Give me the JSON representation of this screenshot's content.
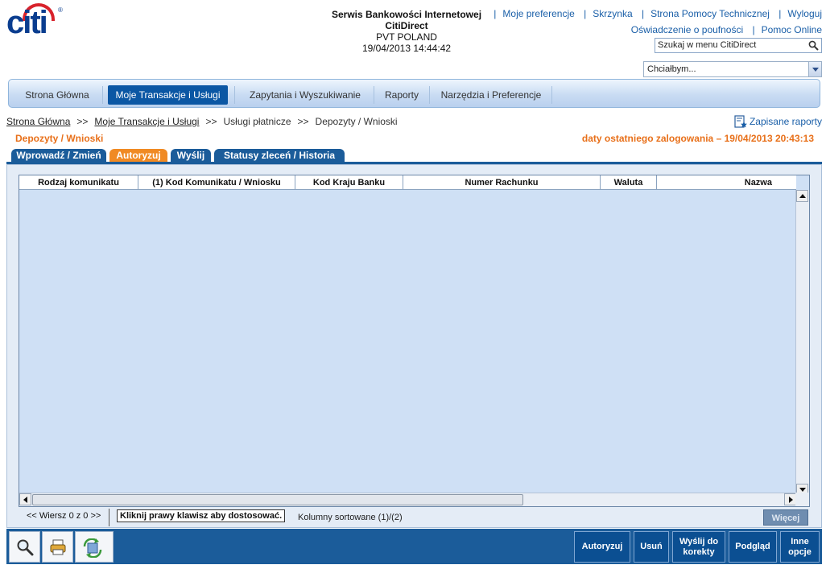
{
  "brand": {
    "logo_text": "citi",
    "registered": "®"
  },
  "header": {
    "service_line1": "Serwis Bankowości Internetowej",
    "service_line2": "CitiDirect",
    "service_line3": "PVT POLAND",
    "service_datetime": "19/04/2013 14:44:42",
    "links_row1": [
      "Moje preferencje",
      "Skrzynka",
      "Strona Pomocy Technicznej",
      "Wyloguj"
    ],
    "links_row2": [
      "Oświadczenie o poufności",
      "Pomoc Online"
    ],
    "search_value": "Szukaj w menu CitiDirect",
    "dropdown_value": "Chciałbym..."
  },
  "mainnav": {
    "items": [
      "Strona Główna",
      "Moje Transakcje i Usługi",
      "Zapytania i Wyszukiwanie",
      "Raporty",
      "Narzędzia i Preferencje"
    ],
    "active": "Moje Transakcje i Usługi"
  },
  "breadcrumb": {
    "items": [
      "Strona Główna",
      "Moje Transakcje i Usługi",
      "Usługi płatnicze",
      "Depozyty / Wnioski"
    ],
    "separator": ">>"
  },
  "saved_reports": "Zapisane raporty",
  "page_title": "Depozyty / Wnioski",
  "last_login": "daty ostatniego zalogowania –  19/04/2013 20:43:13",
  "tabs": [
    "Wprowadź / Zmień",
    "Autoryzuj",
    "Wyślij",
    "Statusy zleceń / Historia"
  ],
  "active_tab": "Autoryzuj",
  "grid": {
    "columns": [
      "Rodzaj komunikatu",
      "(1) Kod Komunikatu / Wniosku",
      "Kod Kraju Banku",
      "Numer Rachunku",
      "Waluta",
      "Nazwa"
    ],
    "rows": []
  },
  "status": {
    "rows_info": "<< Wiersz 0 z 0 >>",
    "hint": "Kliknij prawy klawisz aby dostosować.",
    "sorted": "Kolumny sortowane (1)/(2)",
    "more": "Więcej"
  },
  "toolbar": {
    "icons": [
      "search-icon",
      "print-icon",
      "refresh-icon"
    ],
    "buttons": [
      "Autoryzuj",
      "Usuń",
      "Wyślij do korekty",
      "Podgląd",
      "Inne opcje"
    ]
  },
  "colors": {
    "brand_blue": "#0a3d8f",
    "brand_red": "#d8222b",
    "accent_orange": "#e8701a",
    "nav_active": "#0b57a4",
    "toolbar": "#1b5c9a"
  }
}
